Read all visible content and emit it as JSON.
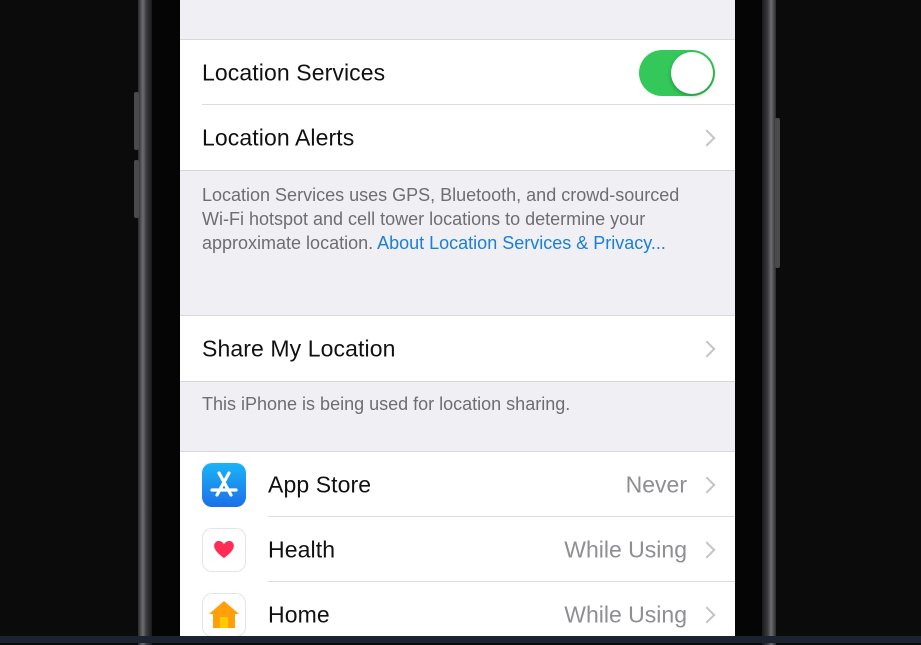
{
  "settings": {
    "location_services": {
      "label": "Location Services",
      "enabled": true
    },
    "location_alerts": {
      "label": "Location Alerts"
    },
    "description": {
      "text": "Location Services uses GPS, Bluetooth, and crowd-sourced Wi-Fi hotspot and cell tower locations to determine your approximate location. ",
      "link": "About Location Services & Privacy..."
    },
    "share_my_location": {
      "label": "Share My Location"
    },
    "share_footer": "This iPhone is being used for location sharing.",
    "apps": [
      {
        "name": "App Store",
        "value": "Never",
        "icon": "app-store-icon"
      },
      {
        "name": "Health",
        "value": "While Using",
        "icon": "health-heart-icon"
      },
      {
        "name": "Home",
        "value": "While Using",
        "icon": "home-house-icon"
      }
    ]
  },
  "colors": {
    "toggle_on": "#34c759",
    "link": "#1a7fd6",
    "background": "#efeff4",
    "secondary_text": "#8e8e93"
  }
}
